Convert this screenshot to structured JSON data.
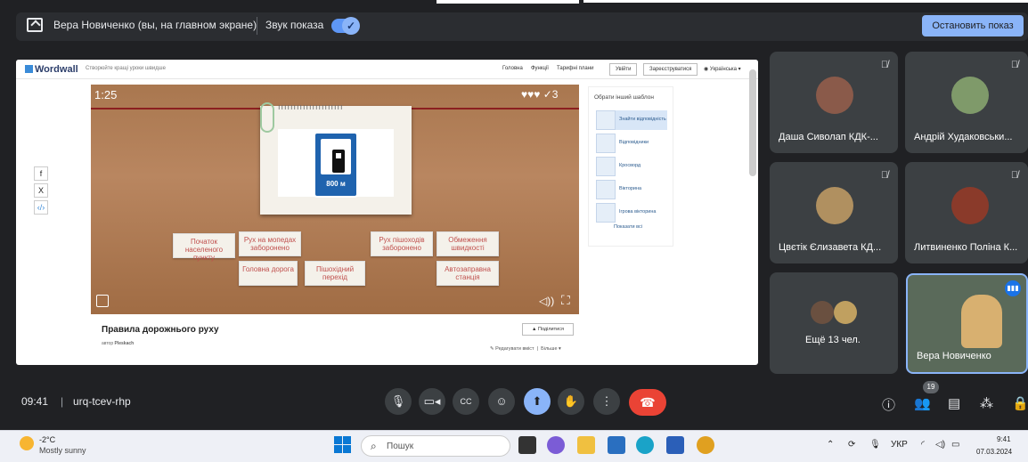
{
  "presenting_bar": {
    "presenter_text": "Вера Новиченко (вы, на главном экране)",
    "sound_label": "Звук показа",
    "stop_button": "Остановить показ"
  },
  "wordwall": {
    "logo": "Wordwall",
    "tagline": "Створюйте кращі уроки швидше",
    "nav": [
      "Головна",
      "Функції",
      "Тарифні плани"
    ],
    "login": "Увійти",
    "register": "Зареєструватися",
    "language": "Українська",
    "timer": "1:25",
    "score": "♥♥♥ ✓3",
    "sign_distance": "800 м",
    "tiles": [
      "Початок населеного пункту",
      "Рух на мопедах заборонено",
      "Рух пішоходів заборонено",
      "Обмеження швидкості",
      "Головна дорога",
      "Пішохідний перехід",
      "Автозаправна станція"
    ],
    "side_panel": {
      "title": "Обрати інший шаблон",
      "templates": [
        "Знайти відповідність",
        "Відповідники",
        "Кросворд",
        "Вікторина",
        "Ігрова вікторина"
      ],
      "show_all": "Показати всі"
    },
    "activity_title": "Правила дорожнього руху",
    "author_label": "автор",
    "author": "Pleskach",
    "share": "Поділитися",
    "edit": "Редагувати вміст",
    "more": "Більше"
  },
  "participants": [
    {
      "name": "Даша Сиволап КДК-...",
      "muted": true
    },
    {
      "name": "Андрій Худаковськи...",
      "muted": true
    },
    {
      "name": "Цвєтік Єлизавета КД...",
      "muted": true
    },
    {
      "name": "Литвиненко Поліна К...",
      "muted": true
    },
    {
      "name": "Ещё 13 чел.",
      "muted": false
    },
    {
      "name": "Вера Новиченко",
      "muted": false
    }
  ],
  "meeting": {
    "time": "09:41",
    "code": "urq-tcev-rhp",
    "participant_count": "19"
  },
  "taskbar": {
    "temperature": "-2°C",
    "weather": "Mostly sunny",
    "search_placeholder": "Пошук",
    "language": "УКР",
    "time": "9:41",
    "date": "07.03.2024"
  },
  "colors": {
    "meet_bg": "#202124",
    "tile_bg": "#3c4043",
    "accent": "#8ab4f8",
    "end_call": "#ea4335"
  }
}
